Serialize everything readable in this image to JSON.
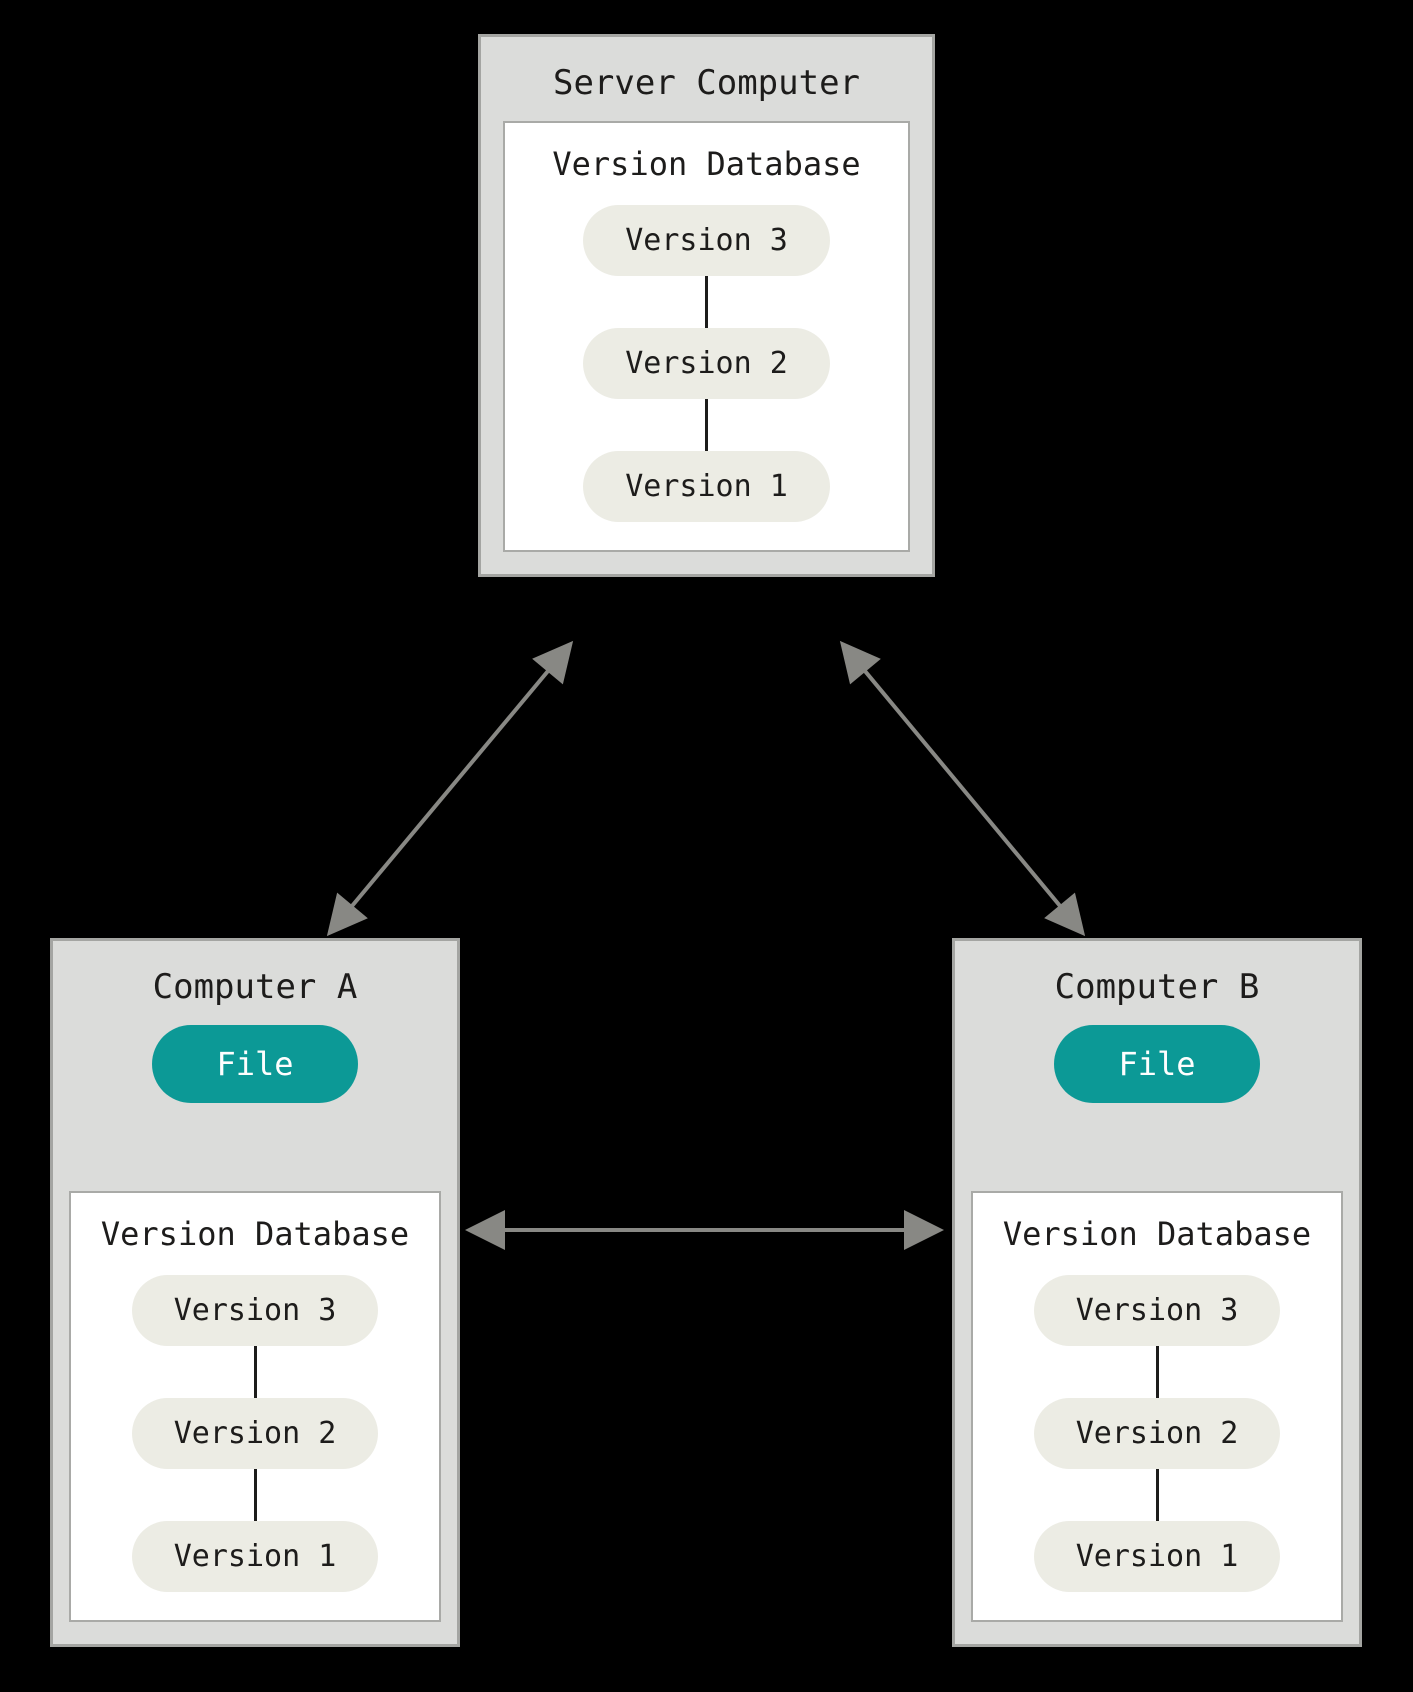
{
  "colors": {
    "bg": "#000000",
    "box_fill": "#dbdcda",
    "box_border": "#a4a5a2",
    "panel_fill": "#ffffff",
    "panel_border": "#a9aaa7",
    "pill_fill": "#ecece4",
    "file_fill": "#0c9996",
    "text": "#1d1c1b",
    "arrow": "#888884"
  },
  "server": {
    "title": "Server Computer",
    "db_title": "Version Database",
    "versions": [
      "Version 3",
      "Version 2",
      "Version 1"
    ]
  },
  "client_a": {
    "title": "Computer A",
    "file_label": "File",
    "db_title": "Version Database",
    "versions": [
      "Version 3",
      "Version 2",
      "Version 1"
    ]
  },
  "client_b": {
    "title": "Computer B",
    "file_label": "File",
    "db_title": "Version Database",
    "versions": [
      "Version 3",
      "Version 2",
      "Version 1"
    ]
  },
  "edges": [
    {
      "from": "server",
      "to": "client_a",
      "bidirectional": true
    },
    {
      "from": "server",
      "to": "client_b",
      "bidirectional": true
    },
    {
      "from": "client_a",
      "to": "client_b",
      "bidirectional": true
    }
  ]
}
